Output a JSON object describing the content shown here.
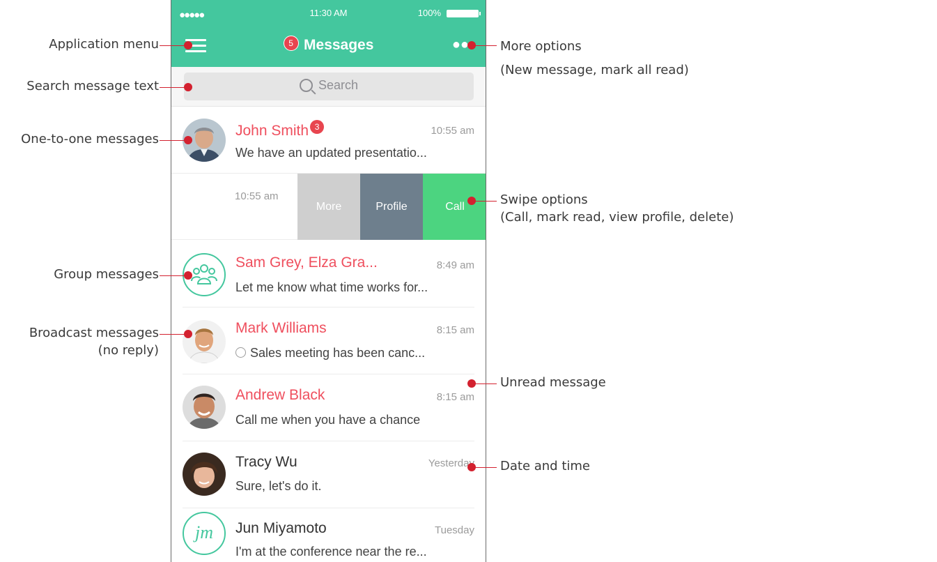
{
  "status_bar": {
    "signal": "●●●●●",
    "time": "11:30 AM",
    "battery": "100%"
  },
  "header": {
    "unread_count": "5",
    "title": "Messages"
  },
  "search": {
    "placeholder": "Search"
  },
  "messages": [
    {
      "name": "John Smith",
      "badge": "3",
      "time": "10:55 am",
      "preview": "We have an updated presentatio...",
      "unread": true
    },
    {
      "name": "Sam Grey, Elza Gra...",
      "time": "8:49 am",
      "preview": "Let me know what time works for...",
      "unread": true
    },
    {
      "name": "Mark Williams",
      "time": "8:15 am",
      "preview": "Sales meeting has been canc...",
      "unread": true
    },
    {
      "name": "Andrew Black",
      "time": "8:15 am",
      "preview": "Call me when you have a chance",
      "unread": true
    },
    {
      "name": "Tracy Wu",
      "time": "Yesterday",
      "preview": "Sure, let's do it.",
      "unread": false
    },
    {
      "name": "Jun Miyamoto",
      "initials": "jm",
      "time": "Tuesday",
      "preview": "I'm at the conference near the re...",
      "unread": false
    }
  ],
  "swipe": {
    "time": "10:55 am",
    "more": "More",
    "profile": "Profile",
    "call": "Call"
  },
  "annotations": {
    "app_menu": "Application menu",
    "search_text": "Search message text",
    "one_to_one": "One-to-one messages",
    "group": "Group messages",
    "broadcast_1": "Broadcast messages",
    "broadcast_2": "(no reply)",
    "more_options_1": "More options",
    "more_options_2": "(New message, mark all read)",
    "swipe_1": "Swipe options",
    "swipe_2": "(Call, mark read, view profile, delete)",
    "unread": "Unread message",
    "date_time": "Date and time"
  },
  "colors": {
    "header": "#44c79e",
    "unread_name": "#ef4f5e",
    "annotation": "#d3212f",
    "call": "#4cd480",
    "profile": "#6e7f8d",
    "more": "#cfcfcf"
  }
}
